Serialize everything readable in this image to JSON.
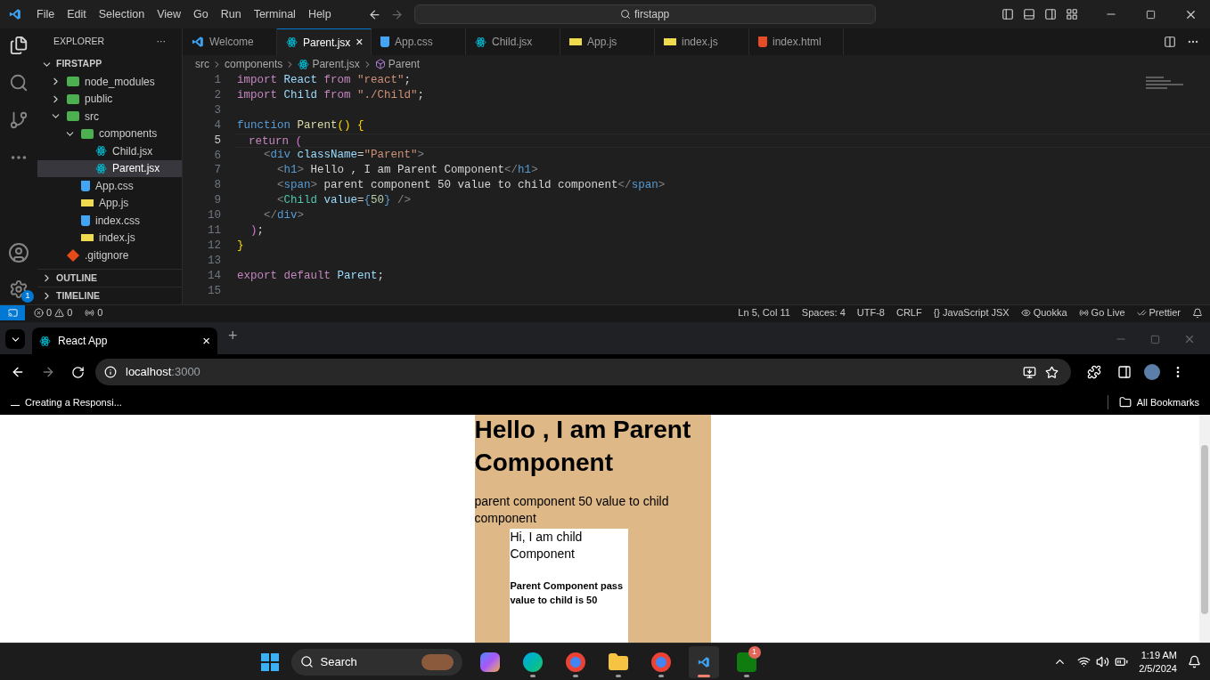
{
  "vscode": {
    "menu": [
      "File",
      "Edit",
      "Selection",
      "View",
      "Go",
      "Run",
      "Terminal",
      "Help"
    ],
    "search": "firstapp",
    "settings_badge": "1",
    "explorer": {
      "title": "EXPLORER",
      "more": "···",
      "root": "FIRSTAPP",
      "tree": [
        {
          "label": "node_modules",
          "kind": "folder",
          "expanded": false,
          "selected": false
        },
        {
          "label": "public",
          "kind": "folder",
          "expanded": false,
          "selected": false
        },
        {
          "label": "src",
          "kind": "folder",
          "expanded": true,
          "selected": false,
          "children": [
            {
              "label": "components",
              "kind": "folder",
              "expanded": true,
              "selected": false,
              "children": [
                {
                  "label": "Child.jsx",
                  "kind": "react",
                  "selected": false
                },
                {
                  "label": "Parent.jsx",
                  "kind": "react",
                  "selected": true
                }
              ]
            },
            {
              "label": "App.css",
              "kind": "css",
              "selected": false
            },
            {
              "label": "App.js",
              "kind": "js",
              "selected": false
            },
            {
              "label": "index.css",
              "kind": "css",
              "selected": false
            },
            {
              "label": "index.js",
              "kind": "js",
              "selected": false
            }
          ]
        },
        {
          "label": ".gitignore",
          "kind": "git",
          "selected": false
        }
      ],
      "sections": [
        "OUTLINE",
        "TIMELINE"
      ]
    },
    "tabs": [
      {
        "label": "Welcome",
        "kind": "vscode",
        "selected": false
      },
      {
        "label": "Parent.jsx",
        "kind": "react",
        "selected": true,
        "close": "×"
      },
      {
        "label": "App.css",
        "kind": "css",
        "selected": false
      },
      {
        "label": "Child.jsx",
        "kind": "react",
        "selected": false
      },
      {
        "label": "App.js",
        "kind": "js",
        "selected": false
      },
      {
        "label": "index.js",
        "kind": "js",
        "selected": false
      },
      {
        "label": "index.html",
        "kind": "html",
        "selected": false
      }
    ],
    "breadcrumb": [
      "src",
      "components",
      "Parent.jsx",
      "Parent"
    ],
    "code": [
      {
        "number": "1",
        "current": false,
        "tokens": [
          {
            "t": "import ",
            "kind": "kw"
          },
          {
            "t": "React ",
            "kind": "var"
          },
          {
            "t": "from ",
            "kind": "kw"
          },
          {
            "t": "\"react\"",
            "kind": "str"
          },
          {
            "t": ";",
            "kind": "plain"
          }
        ]
      },
      {
        "number": "2",
        "current": false,
        "tokens": [
          {
            "t": "import ",
            "kind": "kw"
          },
          {
            "t": "Child ",
            "kind": "var"
          },
          {
            "t": "from ",
            "kind": "kw"
          },
          {
            "t": "\"./Child\"",
            "kind": "str"
          },
          {
            "t": ";",
            "kind": "plain"
          }
        ]
      },
      {
        "number": "3",
        "current": false
      },
      {
        "number": "4",
        "current": false,
        "tokens": [
          {
            "t": "function ",
            "kind": "decl"
          },
          {
            "t": "Parent",
            "kind": "fn"
          },
          {
            "t": "() ",
            "kind": "brace"
          },
          {
            "t": "{",
            "kind": "brace"
          }
        ]
      },
      {
        "number": "5",
        "current": true,
        "tokens": [
          {
            "t": "  return ",
            "kind": "kw"
          },
          {
            "t": "(",
            "kind": "paren"
          }
        ]
      },
      {
        "number": "6",
        "current": false,
        "tokens": [
          {
            "t": "    <",
            "kind": "punct"
          },
          {
            "t": "div ",
            "kind": "tag"
          },
          {
            "t": "className",
            "kind": "var"
          },
          {
            "t": "=",
            "kind": "plain"
          },
          {
            "t": "\"Parent\"",
            "kind": "str"
          },
          {
            "t": ">",
            "kind": "punct"
          }
        ]
      },
      {
        "number": "7",
        "current": false,
        "tokens": [
          {
            "t": "      <",
            "kind": "punct"
          },
          {
            "t": "h1",
            "kind": "tag"
          },
          {
            "t": "> ",
            "kind": "punct"
          },
          {
            "t": "Hello , I am Parent Component",
            "kind": "plain"
          },
          {
            "t": "</",
            "kind": "punct"
          },
          {
            "t": "h1",
            "kind": "tag"
          },
          {
            "t": ">",
            "kind": "punct"
          }
        ]
      },
      {
        "number": "8",
        "current": false,
        "tokens": [
          {
            "t": "      <",
            "kind": "punct"
          },
          {
            "t": "span",
            "kind": "tag"
          },
          {
            "t": "> ",
            "kind": "punct"
          },
          {
            "t": "parent component 50 value to child component",
            "kind": "plain"
          },
          {
            "t": "</",
            "kind": "punct"
          },
          {
            "t": "span",
            "kind": "tag"
          },
          {
            "t": ">",
            "kind": "punct"
          }
        ]
      },
      {
        "number": "9",
        "current": false,
        "tokens": [
          {
            "t": "      <",
            "kind": "punct"
          },
          {
            "t": "Child ",
            "kind": "comp"
          },
          {
            "t": "value",
            "kind": "var"
          },
          {
            "t": "=",
            "kind": "plain"
          },
          {
            "t": "{",
            "kind": "jsxbrace"
          },
          {
            "t": "50",
            "kind": "num"
          },
          {
            "t": "}",
            "kind": "jsxbrace"
          },
          {
            "t": " />",
            "kind": "punct"
          }
        ]
      },
      {
        "number": "10",
        "current": false,
        "tokens": [
          {
            "t": "    </",
            "kind": "punct"
          },
          {
            "t": "div",
            "kind": "tag"
          },
          {
            "t": ">",
            "kind": "punct"
          }
        ]
      },
      {
        "number": "11",
        "current": false,
        "tokens": [
          {
            "t": "  )",
            "kind": "paren"
          },
          {
            "t": ";",
            "kind": "plain"
          }
        ]
      },
      {
        "number": "12",
        "current": false,
        "tokens": [
          {
            "t": "}",
            "kind": "brace"
          }
        ]
      },
      {
        "number": "13",
        "current": false
      },
      {
        "number": "14",
        "current": false,
        "tokens": [
          {
            "t": "export ",
            "kind": "kw"
          },
          {
            "t": "default ",
            "kind": "kw"
          },
          {
            "t": "Parent",
            "kind": "var"
          },
          {
            "t": ";",
            "kind": "plain"
          }
        ]
      },
      {
        "number": "15",
        "current": false
      }
    ],
    "status": {
      "errors": "0",
      "warnings": "0",
      "ports": "0",
      "right": [
        {
          "label": "Ln 5, Col 11",
          "kind": "text"
        },
        {
          "label": "Spaces: 4",
          "kind": "text"
        },
        {
          "label": "UTF-8",
          "kind": "text"
        },
        {
          "label": "CRLF",
          "kind": "text"
        },
        {
          "label": "{} JavaScript JSX",
          "kind": "text"
        },
        {
          "label": "Quokka",
          "kind": "eye"
        },
        {
          "label": "Go Live",
          "kind": "live"
        },
        {
          "label": "Prettier",
          "kind": "check"
        }
      ]
    }
  },
  "browser": {
    "tab": {
      "title": "React App",
      "close": "×"
    },
    "new_tab": "+",
    "url": {
      "host": "localhost",
      "port": ":3000"
    },
    "bookmark": "Creating a Responsi...",
    "all_bookmarks": "All Bookmarks",
    "page": {
      "heading": "Hello , I am Parent Component",
      "text": "parent component 50 value to child component",
      "child": {
        "heading": "Hi, I am child Component",
        "note": "Parent Component pass value to child is 50"
      }
    }
  },
  "taskbar": {
    "search": "Search",
    "apps": [
      {
        "kind": "copilot",
        "running": false,
        "active": false
      },
      {
        "kind": "edge",
        "running": true,
        "active": false
      },
      {
        "kind": "chrome",
        "running": true,
        "active": false
      },
      {
        "kind": "files",
        "running": true,
        "active": false
      },
      {
        "kind": "chrome",
        "running": true,
        "active": false
      },
      {
        "kind": "vscode",
        "running": true,
        "active": true
      },
      {
        "kind": "xbox",
        "running": true,
        "active": false,
        "badge": "1"
      }
    ],
    "time": "1:19 AM",
    "date": "2/5/2024"
  }
}
